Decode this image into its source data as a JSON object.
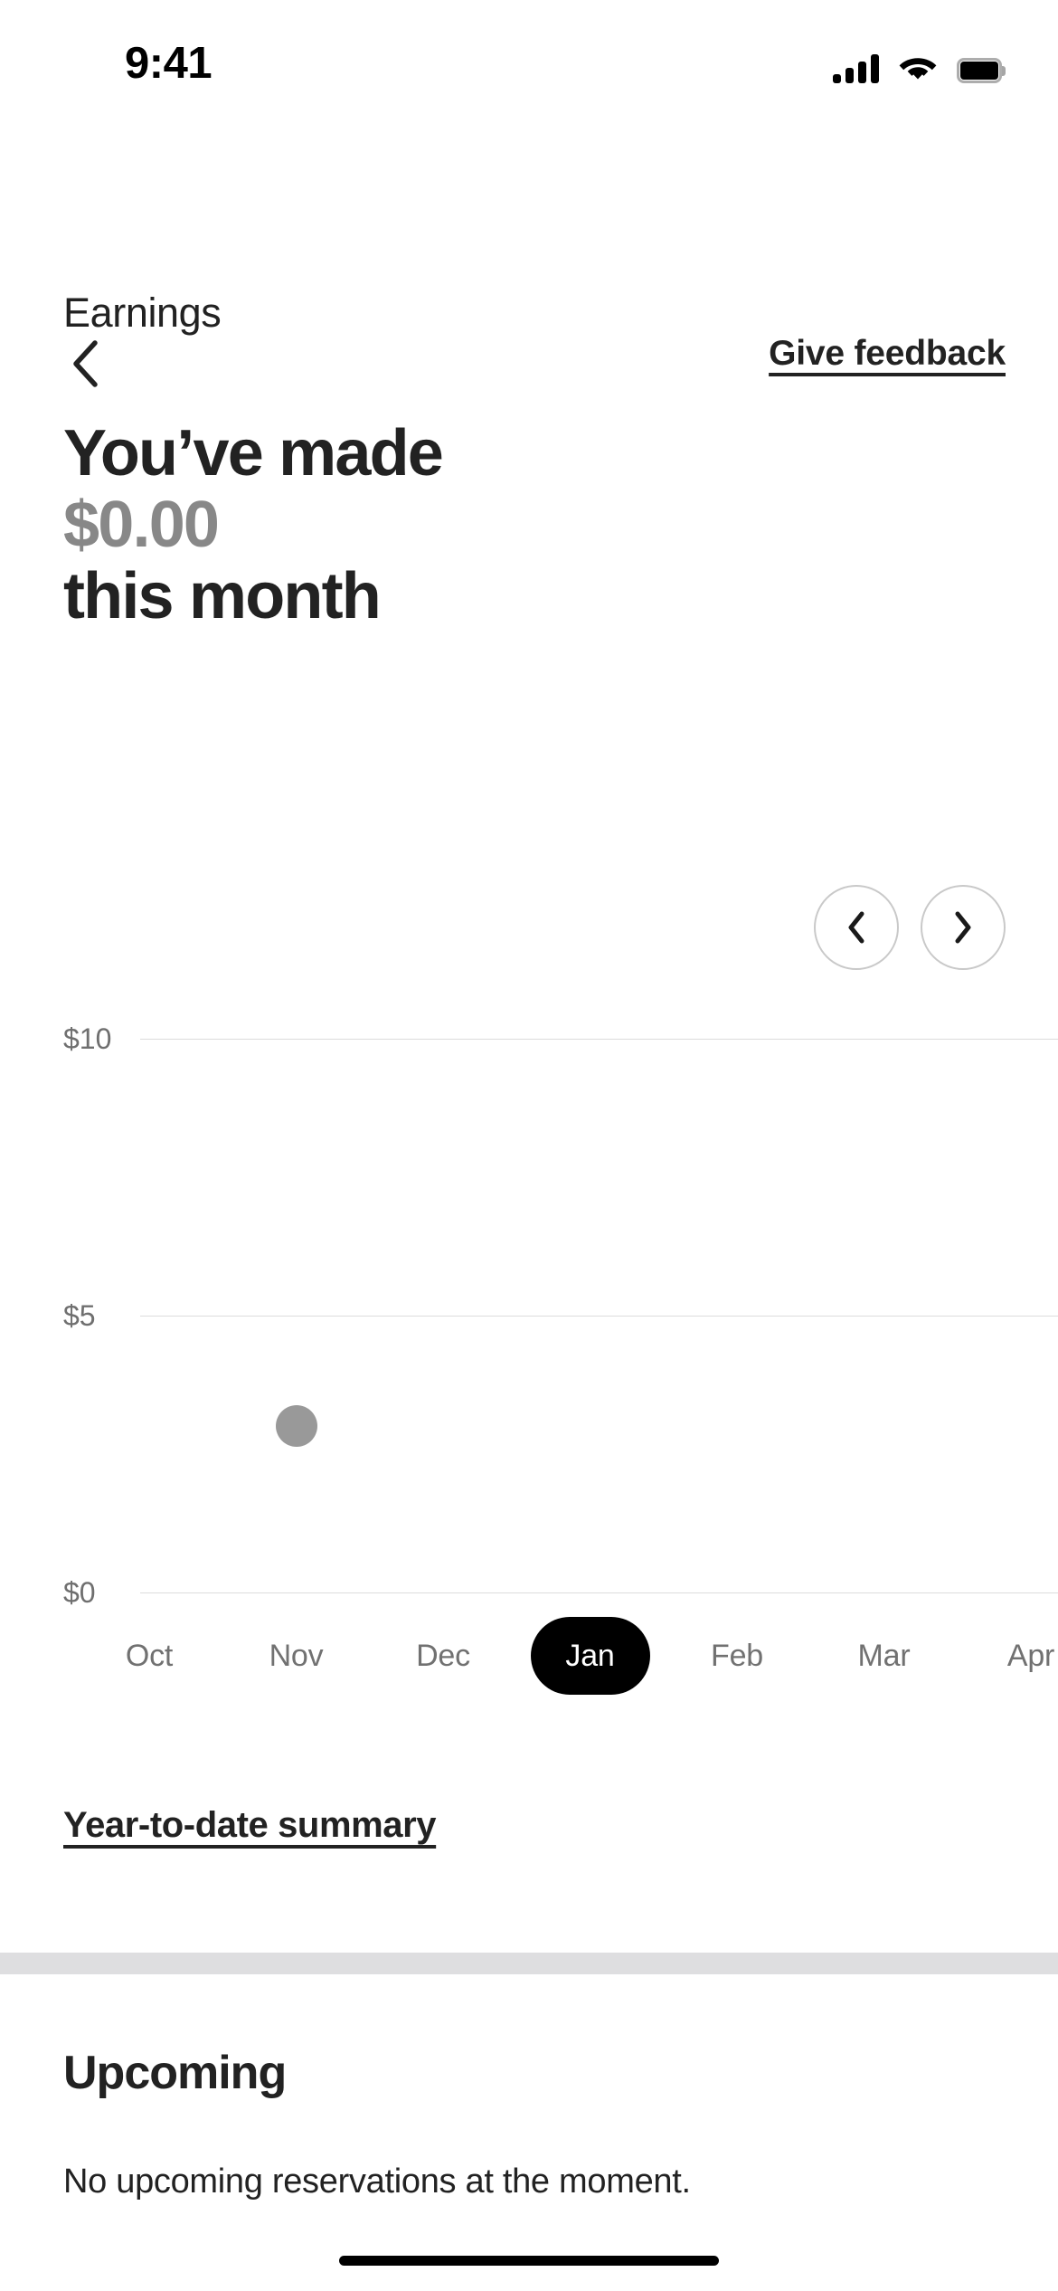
{
  "status_bar": {
    "time": "9:41",
    "cellular_icon": "cellular-signal-icon",
    "wifi_icon": "wifi-icon",
    "battery_icon": "battery-full-icon"
  },
  "nav": {
    "back_icon": "chevron-left-icon",
    "feedback_label": "Give feedback"
  },
  "header": {
    "eyebrow": "Earnings",
    "line1": "You’ve made",
    "amount": "$0.00",
    "line2": "this month",
    "amount_color": "#888888",
    "text_color": "#222222"
  },
  "chart_nav": {
    "prev_icon": "chevron-left-icon",
    "next_icon": "chevron-right-icon"
  },
  "chart_data": {
    "type": "scatter",
    "title": "",
    "xlabel": "",
    "ylabel": "",
    "categories": [
      "Oct",
      "Nov",
      "Dec",
      "Jan",
      "Feb",
      "Mar",
      "Apr"
    ],
    "values": [
      null,
      3.0,
      null,
      null,
      null,
      null,
      null
    ],
    "y_ticks": [
      "$0",
      "$5",
      "$10"
    ],
    "y_tick_values": [
      0,
      5,
      10
    ],
    "ylim": [
      0,
      10
    ],
    "grid": true,
    "legend": "none",
    "selected_category": "Jan",
    "point_color": "#999999",
    "gridline_color": "#dcdcdc",
    "tick_label_color": "#6f6f6f",
    "month_label_color": "#717171",
    "selected_pill_bg": "#000000",
    "selected_pill_text": "#ffffff"
  },
  "ytd": {
    "link_label": "Year-to-date summary"
  },
  "upcoming": {
    "title": "Upcoming",
    "empty_message": "No upcoming reservations at the moment."
  }
}
